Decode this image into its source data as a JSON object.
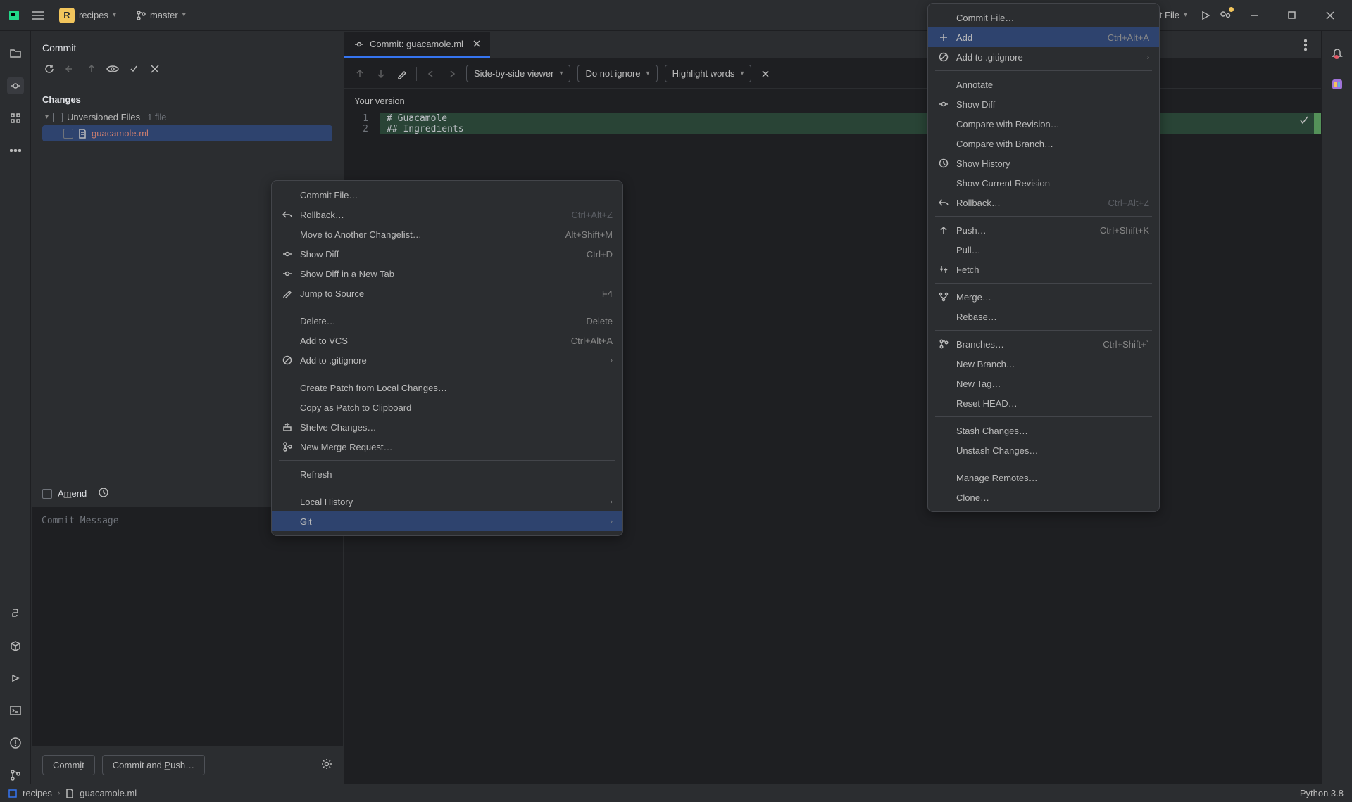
{
  "titlebar": {
    "project_letter": "R",
    "project": "recipes",
    "branch": "master",
    "run_label": "Current File"
  },
  "window": {
    "minimize": "−",
    "maximize": "⬜",
    "close": "✕"
  },
  "commit_panel": {
    "title": "Commit",
    "changes_label": "Changes",
    "unversioned_label": "Unversioned Files",
    "unversioned_count": "1 file",
    "file": "guacamole.ml",
    "amend_label": "Amend",
    "msg_placeholder": "Commit Message",
    "commit_btn": "Commit",
    "commit_push_btn": "Commit and Push…"
  },
  "tab": {
    "label": "Commit: guacamole.ml"
  },
  "editor_toolbar": {
    "viewer": "Side-by-side viewer",
    "ignore": "Do not ignore",
    "highlight": "Highlight words"
  },
  "editor": {
    "version": "Your version",
    "line1_num": "1",
    "line1": "# Guacamole",
    "line2_num": "2",
    "line2": "## Ingredients"
  },
  "menu1": {
    "items": [
      {
        "label": "Commit File…",
        "icon": ""
      },
      {
        "label": "Rollback…",
        "shortcut": "Ctrl+Alt+Z",
        "icon": "undo",
        "disabled": true
      },
      {
        "label": "Move to Another Changelist…",
        "shortcut": "Alt+Shift+M"
      },
      {
        "label": "Show Diff",
        "shortcut": "Ctrl+D",
        "icon": "diff"
      },
      {
        "label": "Show Diff in a New Tab",
        "icon": "diff"
      },
      {
        "label": "Jump to Source",
        "shortcut": "F4",
        "icon": "edit"
      },
      {
        "sep": true
      },
      {
        "label": "Delete…",
        "shortcut": "Delete"
      },
      {
        "label": "Add to VCS",
        "shortcut": "Ctrl+Alt+A"
      },
      {
        "label": "Add to .gitignore",
        "sub": true,
        "icon": "ban"
      },
      {
        "sep": true
      },
      {
        "label": "Create Patch from Local Changes…",
        "disabled": true
      },
      {
        "label": "Copy as Patch to Clipboard"
      },
      {
        "label": "Shelve Changes…",
        "icon": "shelve",
        "disabled": true
      },
      {
        "label": "New Merge Request…",
        "icon": "merge"
      },
      {
        "sep": true
      },
      {
        "label": "Refresh"
      },
      {
        "sep": true
      },
      {
        "label": "Local History",
        "sub": true
      },
      {
        "label": "Git",
        "sub": true,
        "hover": true
      }
    ]
  },
  "menu2": {
    "items": [
      {
        "label": "Commit File…"
      },
      {
        "label": "Add",
        "shortcut": "Ctrl+Alt+A",
        "icon": "plus",
        "hover": true
      },
      {
        "label": "Add to .gitignore",
        "sub": true,
        "icon": "ban"
      },
      {
        "sep": true
      },
      {
        "label": "Annotate",
        "disabled": true
      },
      {
        "label": "Show Diff",
        "disabled": true,
        "icon": "diff"
      },
      {
        "label": "Compare with Revision…",
        "disabled": true
      },
      {
        "label": "Compare with Branch…",
        "disabled": true
      },
      {
        "label": "Show History",
        "icon": "clock"
      },
      {
        "label": "Show Current Revision",
        "disabled": true
      },
      {
        "label": "Rollback…",
        "shortcut": "Ctrl+Alt+Z",
        "icon": "undo",
        "disabled": true
      },
      {
        "sep": true
      },
      {
        "label": "Push…",
        "shortcut": "Ctrl+Shift+K",
        "icon": "push"
      },
      {
        "label": "Pull…"
      },
      {
        "label": "Fetch",
        "icon": "fetch",
        "disabled": true
      },
      {
        "sep": true
      },
      {
        "label": "Merge…",
        "icon": "merge2"
      },
      {
        "label": "Rebase…"
      },
      {
        "sep": true
      },
      {
        "label": "Branches…",
        "shortcut": "Ctrl+Shift+`",
        "icon": "branch"
      },
      {
        "label": "New Branch…",
        "disabled": true
      },
      {
        "label": "New Tag…"
      },
      {
        "label": "Reset HEAD…"
      },
      {
        "sep": true
      },
      {
        "label": "Stash Changes…"
      },
      {
        "label": "Unstash Changes…"
      },
      {
        "sep": true
      },
      {
        "label": "Manage Remotes…"
      },
      {
        "label": "Clone…"
      }
    ]
  },
  "statusbar": {
    "crumb1": "recipes",
    "crumb2": "guacamole.ml",
    "interpreter": "Python 3.8"
  }
}
